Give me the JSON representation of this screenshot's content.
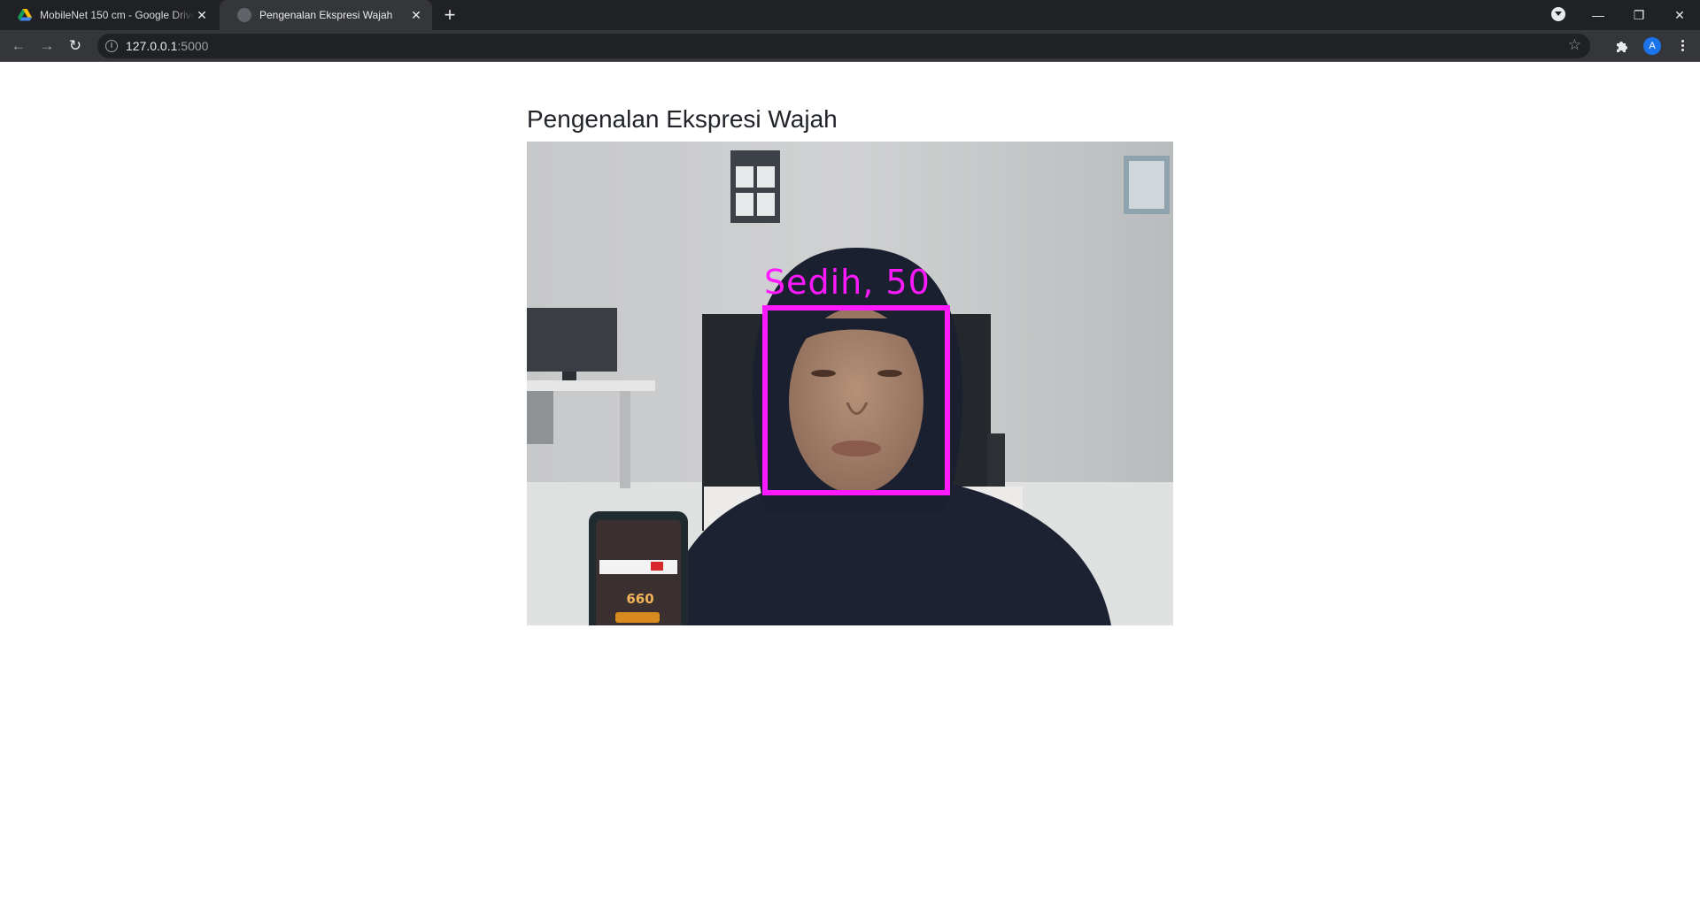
{
  "browser": {
    "tabs": [
      {
        "title": "MobileNet 150 cm - Google Drive",
        "close": "✕",
        "active": false
      },
      {
        "title": "Pengenalan Ekspresi Wajah",
        "close": "✕",
        "active": true
      }
    ],
    "new_tab": "+",
    "window_controls": {
      "minimize": "—",
      "restore": "❐",
      "close": "✕"
    },
    "nav": {
      "back": "←",
      "forward": "→",
      "reload": "↻"
    },
    "address": {
      "host": "127.0.0.1",
      "port": ":5000"
    },
    "bookmark": "☆",
    "profile_initial": "A"
  },
  "page": {
    "title": "Pengenalan Ekspresi Wajah",
    "detection": {
      "label": "Sedih, 50",
      "color": "#ff19ff"
    },
    "phone_score": "660"
  }
}
